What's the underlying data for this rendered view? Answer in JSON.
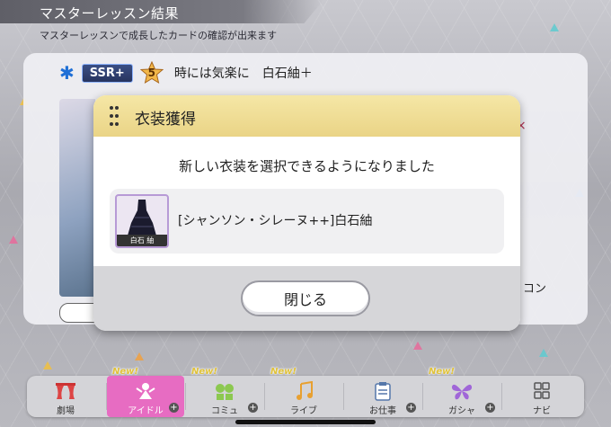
{
  "header": {
    "title": "マスターレッスン結果",
    "subtitle": "マスターレッスンで成長したカードの確認が出来ます"
  },
  "card": {
    "rarity": "SSR+",
    "rank": "5",
    "name": "時には気楽に　白石紬＋",
    "peek_text": "コン",
    "peek_mark": "×"
  },
  "modal": {
    "title": "衣装獲得",
    "message": "新しい衣装を選択できるようになりました",
    "item": {
      "thumb_label": "白石 紬",
      "name": "[シャンソン・シレーヌ++]白石紬"
    },
    "close_label": "閉じる"
  },
  "nav": {
    "items": [
      {
        "label": "劇場",
        "icon": "theater-curtain-icon",
        "new": "",
        "plus": false,
        "active": false
      },
      {
        "label": "アイドル",
        "icon": "idol-icon",
        "new": "New!",
        "plus": true,
        "active": true
      },
      {
        "label": "コミュ",
        "icon": "commu-icon",
        "new": "New!",
        "plus": true,
        "active": false
      },
      {
        "label": "ライブ",
        "icon": "live-music-icon",
        "new": "New!",
        "plus": false,
        "active": false
      },
      {
        "label": "お仕事",
        "icon": "work-clipboard-icon",
        "new": "",
        "plus": true,
        "active": false
      },
      {
        "label": "ガシャ",
        "icon": "gacha-butterfly-icon",
        "new": "New!",
        "plus": true,
        "active": false
      },
      {
        "label": "ナビ",
        "icon": "navi-grid-icon",
        "new": "",
        "plus": false,
        "active": false
      }
    ]
  },
  "colors": {
    "accent_pink": "#e76cc2",
    "modal_header": "#f0dd94",
    "ssr_badge": "#2f3f70"
  }
}
